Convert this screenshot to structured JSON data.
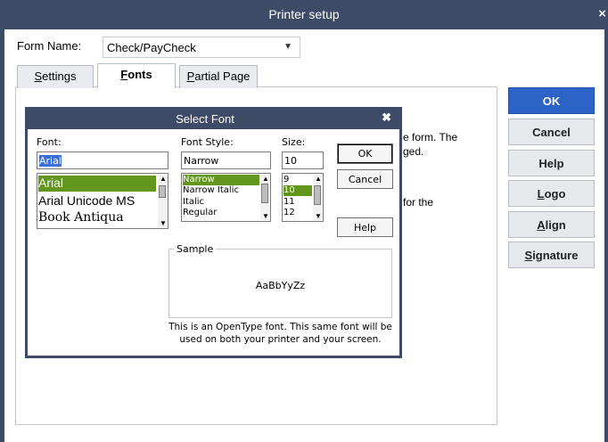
{
  "window": {
    "title": "Printer setup",
    "close_glyph": "×"
  },
  "form": {
    "label": "Form Name:",
    "value": "Check/PayCheck",
    "arrow": "▼"
  },
  "tabs": [
    {
      "label": "Settings",
      "mnemonic": "S"
    },
    {
      "label": "Fonts",
      "mnemonic": "F"
    },
    {
      "label": "Partial Page",
      "mnemonic": "P"
    }
  ],
  "background_text": {
    "form_fragment": "e form. The",
    "ged_fragment": "ged.",
    "for_the_fragment": "for the"
  },
  "side_buttons": [
    {
      "label": "OK",
      "mnemonic": ""
    },
    {
      "label": "Cancel",
      "mnemonic": ""
    },
    {
      "label": "Help",
      "mnemonic": ""
    },
    {
      "label": "Logo",
      "mnemonic": "L"
    },
    {
      "label": "Align",
      "mnemonic": "A"
    },
    {
      "label": "Signature",
      "mnemonic": "S"
    }
  ],
  "font_dialog": {
    "title": "Select Font",
    "close_glyph": "✖",
    "font_label": "Font:",
    "font_value": "Arial",
    "fonts": [
      "Arial",
      "Arial Unicode MS",
      "Book Antiqua"
    ],
    "style_label": "Font Style:",
    "style_value": "Narrow",
    "styles": [
      "Narrow",
      "Narrow Italic",
      "Italic",
      "Regular"
    ],
    "size_label": "Size:",
    "size_value": "10",
    "sizes": [
      "9",
      "10",
      "11",
      "12"
    ],
    "ok": "OK",
    "cancel": "Cancel",
    "help": "Help",
    "sample_label": "Sample",
    "sample_text": "AaBbYyZz",
    "note_line1": "This is an OpenType font. This same font will be",
    "note_line2": "used on both your printer and your screen."
  }
}
